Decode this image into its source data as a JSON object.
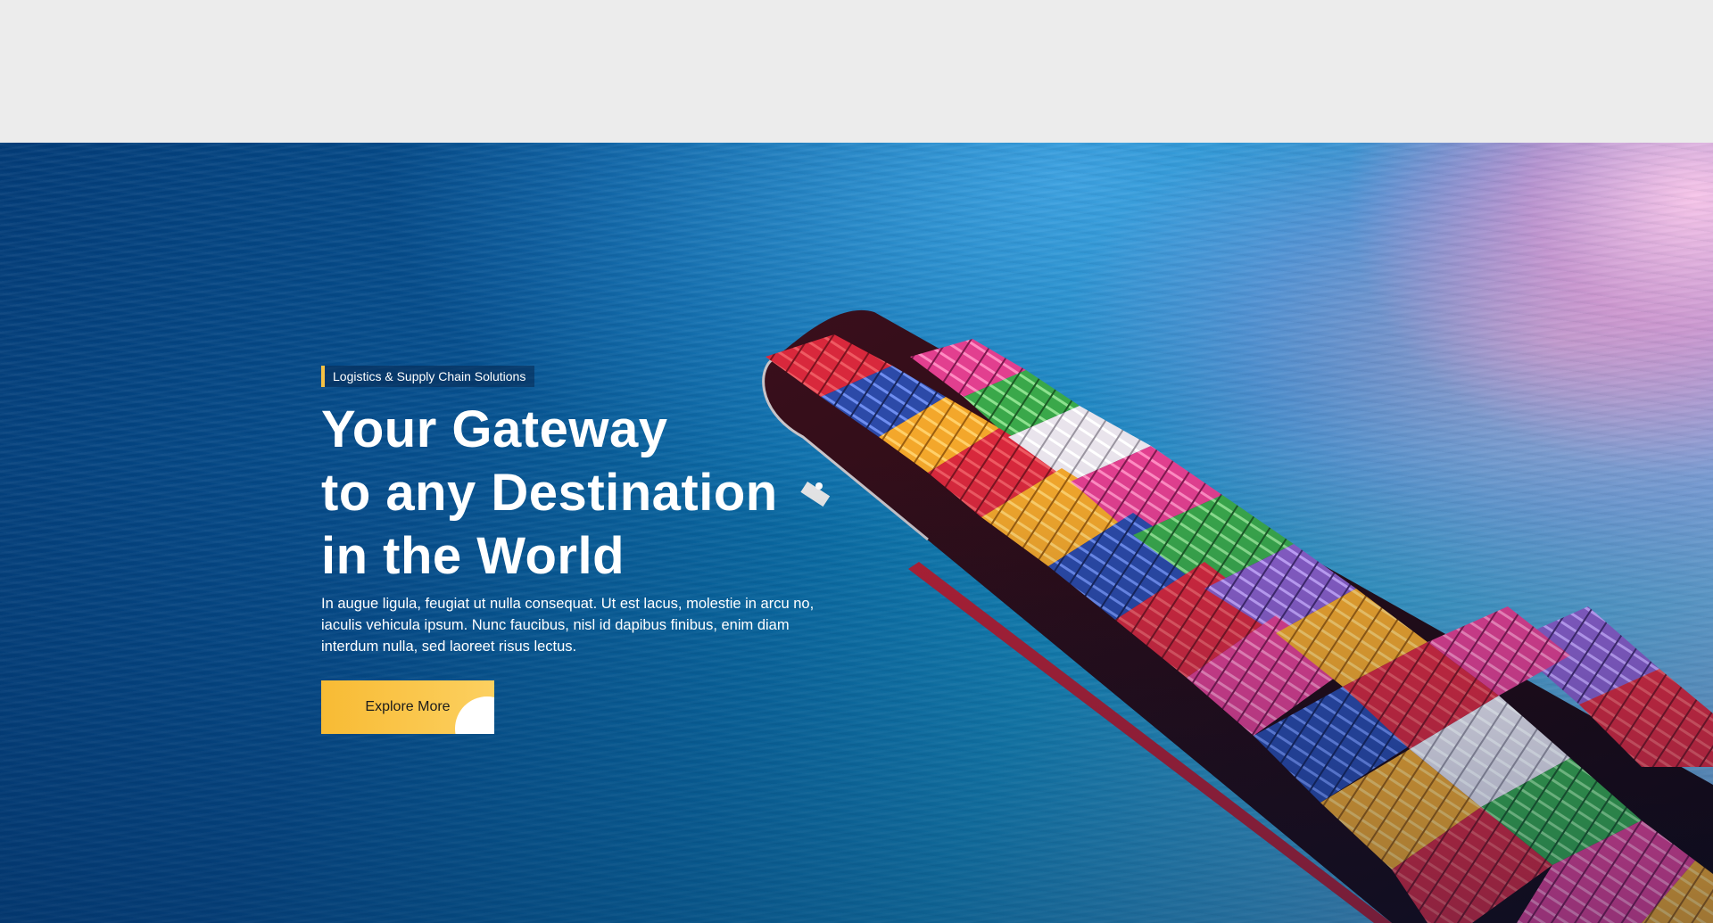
{
  "hero": {
    "tagline": "Logistics & Supply Chain Solutions",
    "headline": {
      "line1": "Your Gateway",
      "line2": "to any Destination",
      "line3": "in the World"
    },
    "description": "In augue ligula, feugiat ut nulla consequat. Ut est lacus, molestie in arcu no, iaculis vehicula ipsum. Nunc faucibus, nisl id dapibus finibus, enim diam interdum nulla, sed laoreet risus lectus.",
    "cta_label": "Explore More"
  },
  "colors": {
    "accent": "#f8bb34",
    "top_band": "#ececec",
    "water_deep": "#033c78",
    "water_light": "#3a9ccb",
    "headline_text": "#ffffff"
  },
  "icons": {
    "cta_corner": "quarter-circle-decoration"
  },
  "background_image": "container-ship-aerial-ocean"
}
